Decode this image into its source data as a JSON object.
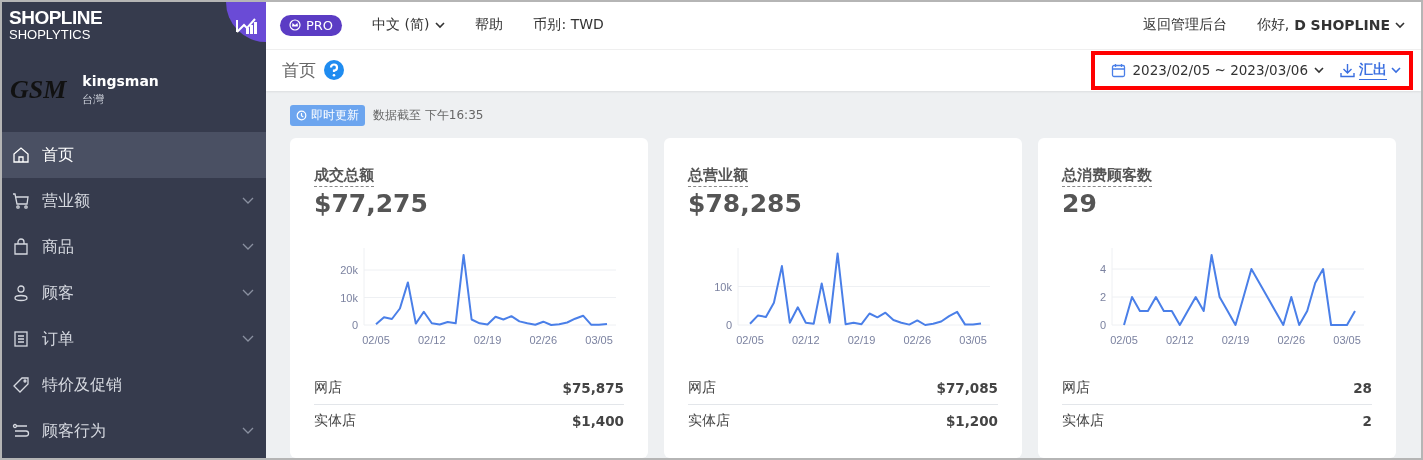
{
  "sidebar": {
    "logo": {
      "brand": "SHOPLINE",
      "product": "SHOPLYTICS"
    },
    "store": {
      "logo_text": "GSM",
      "name": "kingsman",
      "region": "台灣"
    },
    "items": [
      {
        "label": "首页",
        "selected": true,
        "expandable": false
      },
      {
        "label": "营业额",
        "selected": false,
        "expandable": true
      },
      {
        "label": "商品",
        "selected": false,
        "expandable": true
      },
      {
        "label": "顾客",
        "selected": false,
        "expandable": true
      },
      {
        "label": "订单",
        "selected": false,
        "expandable": true
      },
      {
        "label": "特价及促销",
        "selected": false,
        "expandable": false
      },
      {
        "label": "顾客行为",
        "selected": false,
        "expandable": true
      }
    ]
  },
  "topbar": {
    "badge": "PRO",
    "language": "中文 (简)",
    "help": "帮助",
    "currency": "币别: TWD",
    "back": "返回管理后台",
    "greeting": "你好,",
    "user": "D SHOPLINE"
  },
  "page": {
    "title": "首页",
    "date_range": "2023/02/05 ~ 2023/03/06",
    "export": "汇出",
    "highlighted": true,
    "live_badge": "即时更新",
    "updated": "数据截至 下午16:35"
  },
  "cards": [
    {
      "title": "成交总额",
      "value": "$77,275",
      "rows": [
        {
          "label": "网店",
          "value": "$75,875"
        },
        {
          "label": "实体店",
          "value": "$1,400"
        }
      ],
      "chart_data": {
        "type": "line",
        "categories": [
          "02/05",
          null,
          null,
          null,
          null,
          null,
          null,
          "02/12",
          null,
          null,
          null,
          null,
          null,
          null,
          "02/19",
          null,
          null,
          null,
          null,
          null,
          null,
          "02/26",
          null,
          null,
          null,
          null,
          null,
          null,
          "03/05",
          null
        ],
        "ylim": [
          0,
          28000
        ],
        "yticks": [
          {
            "value": 0,
            "label": "0"
          },
          {
            "value": 10000,
            "label": "10k"
          },
          {
            "value": 20000,
            "label": "20k"
          }
        ],
        "series": [
          {
            "color": "#4a7fe8",
            "values": [
              300,
              2800,
              2200,
              6000,
              15500,
              500,
              4800,
              600,
              200,
              1100,
              600,
              25500,
              2000,
              600,
              200,
              3000,
              2000,
              3200,
              1300,
              600,
              100,
              1200,
              0,
              300,
              900,
              2300,
              3400,
              100,
              100,
              400
            ]
          }
        ]
      }
    },
    {
      "title": "总营业额",
      "value": "$78,285",
      "rows": [
        {
          "label": "网店",
          "value": "$77,085"
        },
        {
          "label": "实体店",
          "value": "$1,200"
        }
      ],
      "chart_data": {
        "type": "line",
        "categories": [
          "02/05",
          null,
          null,
          null,
          null,
          null,
          null,
          "02/12",
          null,
          null,
          null,
          null,
          null,
          null,
          "02/19",
          null,
          null,
          null,
          null,
          null,
          null,
          "02/26",
          null,
          null,
          null,
          null,
          null,
          null,
          "03/05",
          null
        ],
        "ylim": [
          0,
          20000
        ],
        "yticks": [
          {
            "value": 0,
            "label": "0"
          },
          {
            "value": 10000,
            "label": "10k"
          }
        ],
        "series": [
          {
            "color": "#4a7fe8",
            "values": [
              300,
              2500,
              2100,
              5800,
              15300,
              600,
              4600,
              600,
              300,
              10800,
              600,
              18600,
              200,
              600,
              200,
              3000,
              2000,
              3200,
              1300,
              600,
              100,
              1200,
              0,
              300,
              900,
              2300,
              3400,
              100,
              100,
              400
            ]
          }
        ]
      }
    },
    {
      "title": "总消费顾客数",
      "value": "29",
      "rows": [
        {
          "label": "网店",
          "value": "28"
        },
        {
          "label": "实体店",
          "value": "2"
        }
      ],
      "chart_data": {
        "type": "line",
        "categories": [
          "02/05",
          null,
          null,
          null,
          null,
          null,
          null,
          "02/12",
          null,
          null,
          null,
          null,
          null,
          null,
          "02/19",
          null,
          null,
          null,
          null,
          null,
          null,
          "02/26",
          null,
          null,
          null,
          null,
          null,
          null,
          "03/05",
          null
        ],
        "ylim": [
          0,
          5.5
        ],
        "yticks": [
          0,
          2,
          4
        ],
        "series": [
          {
            "color": "#4a7fe8",
            "values": [
              0,
              2,
              1,
              1,
              2,
              1,
              1,
              0,
              1,
              2,
              1,
              5,
              2,
              1,
              0,
              2,
              4,
              3,
              2,
              1,
              0,
              2,
              0,
              1,
              3,
              4,
              0,
              0,
              0,
              1
            ]
          }
        ]
      }
    }
  ]
}
